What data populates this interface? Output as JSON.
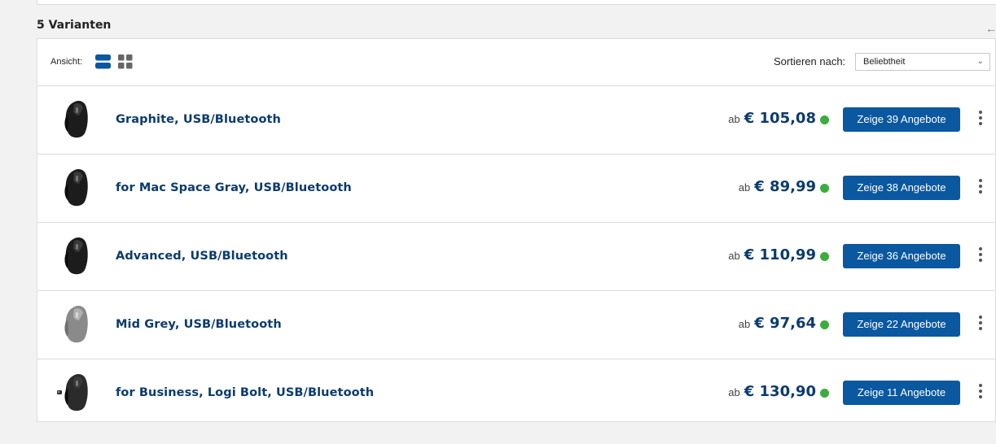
{
  "heading": "5 Varianten",
  "toolbar": {
    "view_label": "Ansicht:",
    "sort_label": "Sortieren nach:",
    "sort_value": "Beliebtheit"
  },
  "colors": {
    "accent": "#0a58a0",
    "link": "#0b3b6e",
    "available": "#3cad3c"
  },
  "variants": [
    {
      "name": "Graphite, USB/Bluetooth",
      "price_prefix": "ab",
      "price": "€ 105,08",
      "offers_label": "Zeige 39 Angebote",
      "mouse_color": "dark"
    },
    {
      "name": "for Mac Space Gray, USB/Bluetooth",
      "price_prefix": "ab",
      "price": "€ 89,99",
      "offers_label": "Zeige 38 Angebote",
      "mouse_color": "dark"
    },
    {
      "name": "Advanced, USB/Bluetooth",
      "price_prefix": "ab",
      "price": "€ 110,99",
      "offers_label": "Zeige 36 Angebote",
      "mouse_color": "dark"
    },
    {
      "name": "Mid Grey, USB/Bluetooth",
      "price_prefix": "ab",
      "price": "€ 97,64",
      "offers_label": "Zeige 22 Angebote",
      "mouse_color": "grey"
    },
    {
      "name": "for Business, Logi Bolt, USB/Bluetooth",
      "price_prefix": "ab",
      "price": "€ 130,90",
      "offers_label": "Zeige 11 Angebote",
      "mouse_color": "dark-with-receiver"
    }
  ]
}
